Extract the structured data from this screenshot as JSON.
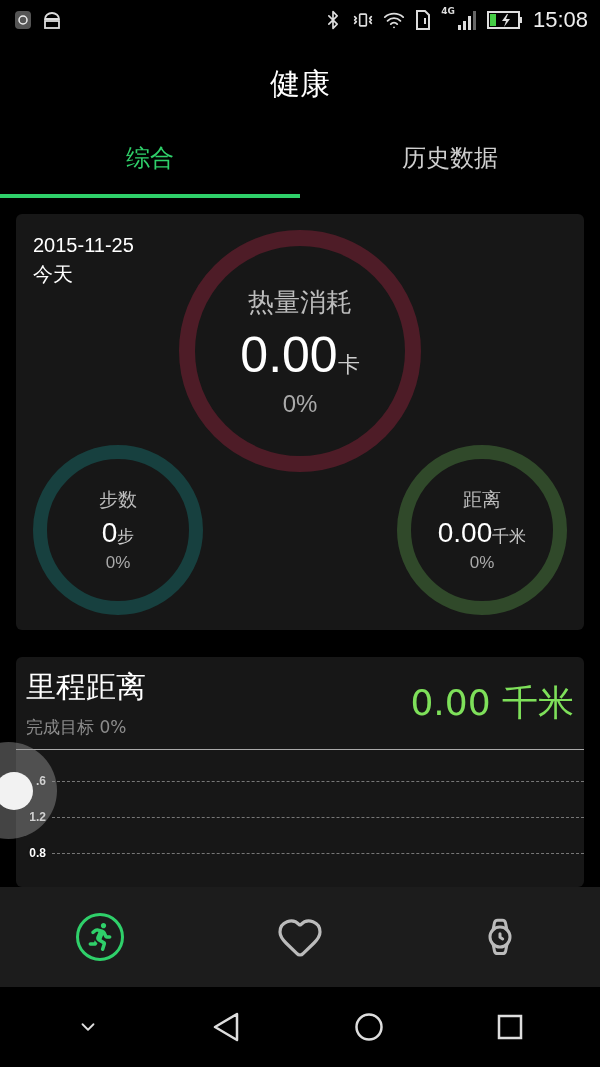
{
  "status_bar": {
    "network": "4G",
    "time": "15:08"
  },
  "header": {
    "title": "健康"
  },
  "tabs": [
    {
      "label": "综合",
      "selected": true
    },
    {
      "label": "历史数据",
      "selected": false
    }
  ],
  "summary": {
    "date": "2015-11-25",
    "day": "今天",
    "rings": [
      {
        "kind": "large",
        "label": "热量消耗",
        "value": "0.00",
        "unit": "卡",
        "percent": "0%",
        "color": "#4e1c27"
      },
      {
        "kind": "small",
        "label": "步数",
        "value": "0",
        "unit": "步",
        "percent": "0%",
        "color": "#17403f"
      },
      {
        "kind": "small",
        "label": "距离",
        "value": "0.00",
        "unit": "千米",
        "percent": "0%",
        "color": "#30492a"
      }
    ]
  },
  "distance": {
    "title": "里程距离",
    "subtitle": "完成目标 0%",
    "value": "0.00 千米",
    "axis_labels": [
      ".6",
      "1.2",
      "0.8"
    ]
  },
  "bottom_nav": [
    {
      "kind": "activity",
      "selected": true
    },
    {
      "kind": "heart",
      "selected": false
    },
    {
      "kind": "watch",
      "selected": false
    }
  ]
}
